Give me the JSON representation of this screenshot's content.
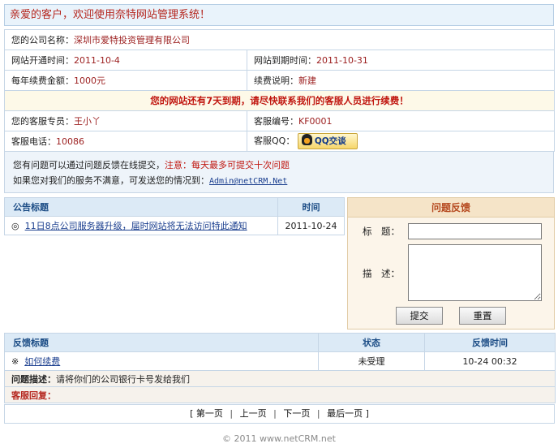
{
  "welcome": "亲爱的客户，欢迎使用奈特网站管理系统！",
  "info": {
    "company_label": "您的公司名称：",
    "company_value": "深圳市爱特投资管理有限公司",
    "open_label": "网站开通时间：",
    "open_value": "2011-10-4",
    "expire_label": "网站到期时间：",
    "expire_value": "2011-10-31",
    "fee_label": "每年续费金额：",
    "fee_value": "1000元",
    "renew_label": "续费说明：",
    "renew_value": "新建",
    "expire_notice": "您的网站还有7天到期，请尽快联系我们的客服人员进行续费！",
    "agent_label": "您的客服专员：",
    "agent_value": "王小丫",
    "agent_no_label": "客服编号：",
    "agent_no_value": "KF0001",
    "phone_label": "客服电话：",
    "phone_value": "10086",
    "qq_label": "客服QQ：",
    "qq_button": "QQ交谈"
  },
  "notice": {
    "line1_prefix": "您有问题可以通过问题反馈在线提交，",
    "line1_warn": "注意：每天最多可提交十次问题",
    "line2_prefix": "如果您对我们的服务不满意，可发送您的情况到：",
    "email": "Admin@netCRM.Net"
  },
  "announcements": {
    "col_title": "公告标题",
    "col_time": "时间",
    "rows": [
      {
        "bullet": "◎",
        "title": "11日8点公司服务器升级，届时网站将无法访问特此通知",
        "time": "2011-10-24"
      }
    ]
  },
  "feedback_form": {
    "heading": "问题反馈",
    "title_label": "标　题：",
    "desc_label": "描　述：",
    "submit": "提交",
    "reset": "重置"
  },
  "feedback_list": {
    "col_title": "反馈标题",
    "col_status": "状态",
    "col_time": "反馈时间",
    "rows": [
      {
        "bullet": "※",
        "title": "如何续费",
        "status": "未受理",
        "time": "10-24 00:32"
      }
    ],
    "desc_label": "问题描述：",
    "desc_value": "请将你们的公司银行卡号发给我们",
    "reply_label": "客服回复："
  },
  "pager": {
    "open": "[",
    "first": "第一页",
    "prev": "上一页",
    "next": "下一页",
    "last": "最后一页",
    "close": "]",
    "sep": "|"
  },
  "copyright": "© 2011 www.netCRM.net",
  "colors": {
    "accent_red": "#c0160f",
    "header_blue": "#1b4c85",
    "panel_orange": "#b5481e"
  }
}
